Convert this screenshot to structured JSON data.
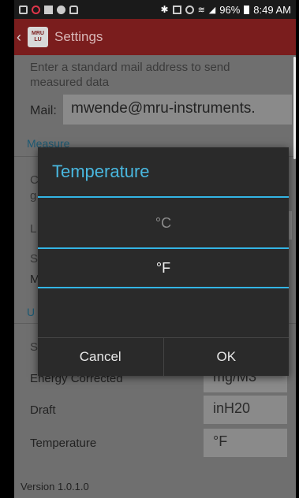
{
  "status_bar": {
    "time": "8:49 AM",
    "battery": "96%"
  },
  "app_bar": {
    "title": "Settings",
    "logo_top": "MRU",
    "logo_bottom": "LU"
  },
  "settings": {
    "mail_description": "Enter a standard mail address to send measured data",
    "mail_label": "Mail:",
    "mail_value": "mwende@mru-instruments.",
    "section_measure": "Measure",
    "section_units": "U",
    "energy_corrected_label": "Energy Corrected",
    "energy_corrected_value": "mg/M3",
    "draft_label": "Draft",
    "draft_value": "inH20",
    "temperature_label": "Temperature",
    "temperature_value": "°F",
    "partial_letters": {
      "measure_desc_a": "C",
      "measure_desc_b": "g",
      "measure_desc_end": "d",
      "row_l": "L",
      "row_s": "S",
      "row_m": "M",
      "units_s": "S"
    }
  },
  "version": "Version 1.0.1.0",
  "dialog": {
    "title": "Temperature",
    "options": [
      {
        "label": "°C",
        "selected": false
      },
      {
        "label": "°F",
        "selected": true
      }
    ],
    "cancel_label": "Cancel",
    "ok_label": "OK"
  },
  "colors": {
    "accent": "#33b5e5",
    "app_bar": "#7a1d1d"
  }
}
